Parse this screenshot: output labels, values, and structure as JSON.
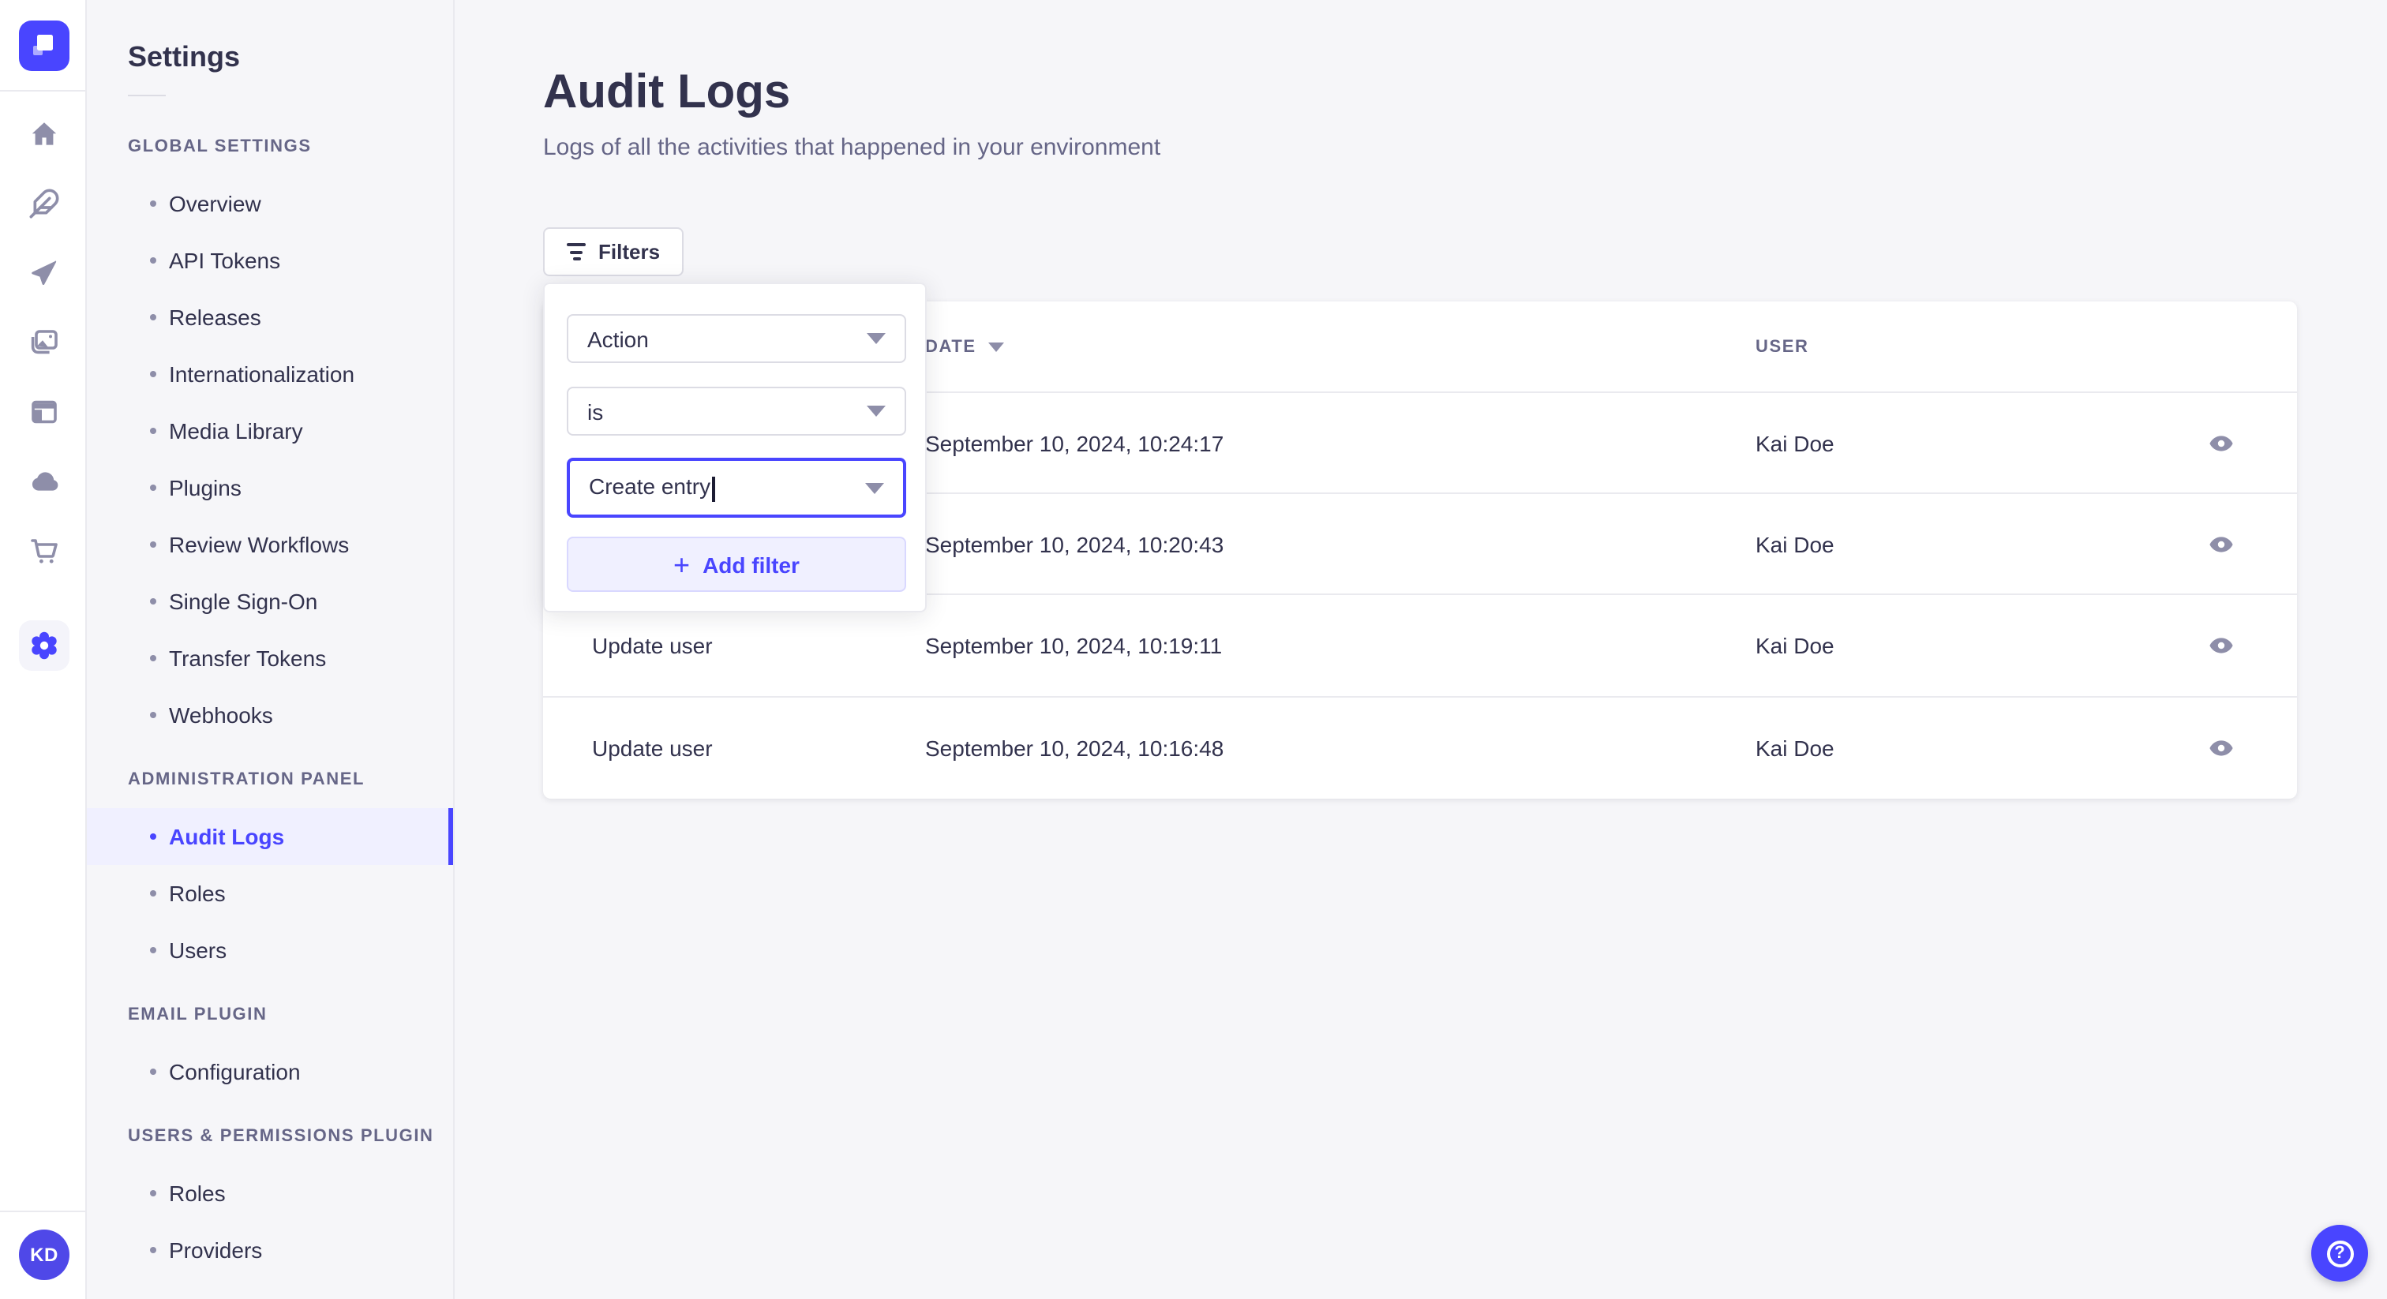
{
  "colors": {
    "primary": "#4945ff",
    "primary_light_bg": "#f0f0ff",
    "text": "#32324d",
    "muted_text": "#666687",
    "icon_gray": "#8e8ea9",
    "divider": "#eaeaef",
    "input_border": "#dcdce4",
    "page_bg": "#f6f6f9"
  },
  "rail": {
    "logo_icon": "strapi-logo",
    "icons": [
      "home-icon",
      "feather-icon",
      "send-icon",
      "media-library-icon",
      "layout-icon",
      "cloud-icon",
      "cart-icon"
    ],
    "active_icon": "gear-icon",
    "avatar_initials": "KD"
  },
  "subnav": {
    "title": "Settings",
    "sections": [
      {
        "label": "GLOBAL SETTINGS",
        "items": [
          {
            "label": "Overview"
          },
          {
            "label": "API Tokens"
          },
          {
            "label": "Releases"
          },
          {
            "label": "Internationalization"
          },
          {
            "label": "Media Library"
          },
          {
            "label": "Plugins"
          },
          {
            "label": "Review Workflows"
          },
          {
            "label": "Single Sign-On"
          },
          {
            "label": "Transfer Tokens"
          },
          {
            "label": "Webhooks"
          }
        ]
      },
      {
        "label": "ADMINISTRATION PANEL",
        "items": [
          {
            "label": "Audit Logs",
            "active": true
          },
          {
            "label": "Roles"
          },
          {
            "label": "Users"
          }
        ]
      },
      {
        "label": "EMAIL PLUGIN",
        "items": [
          {
            "label": "Configuration"
          }
        ]
      },
      {
        "label": "USERS & PERMISSIONS PLUGIN",
        "items": [
          {
            "label": "Roles"
          },
          {
            "label": "Providers"
          }
        ]
      }
    ]
  },
  "main": {
    "title": "Audit Logs",
    "subtitle": "Logs of all the activities that happened in your environment",
    "filters_button_label": "Filters",
    "filter_popover": {
      "field_value": "Action",
      "operator_value": "is",
      "value_value": "Create entry",
      "add_filter_label": "Add filter"
    },
    "table": {
      "columns": {
        "action_label": "",
        "date_label": "DATE",
        "user_label": "USER"
      },
      "date_sorted_desc": true,
      "rows": [
        {
          "action": "",
          "date": "September 10, 2024, 10:24:17",
          "user": "Kai Doe"
        },
        {
          "action": "",
          "date": "September 10, 2024, 10:20:43",
          "user": "Kai Doe"
        },
        {
          "action": "Update user",
          "date": "September 10, 2024, 10:19:11",
          "user": "Kai Doe"
        },
        {
          "action": "Update user",
          "date": "September 10, 2024, 10:16:48",
          "user": "Kai Doe"
        }
      ]
    }
  }
}
